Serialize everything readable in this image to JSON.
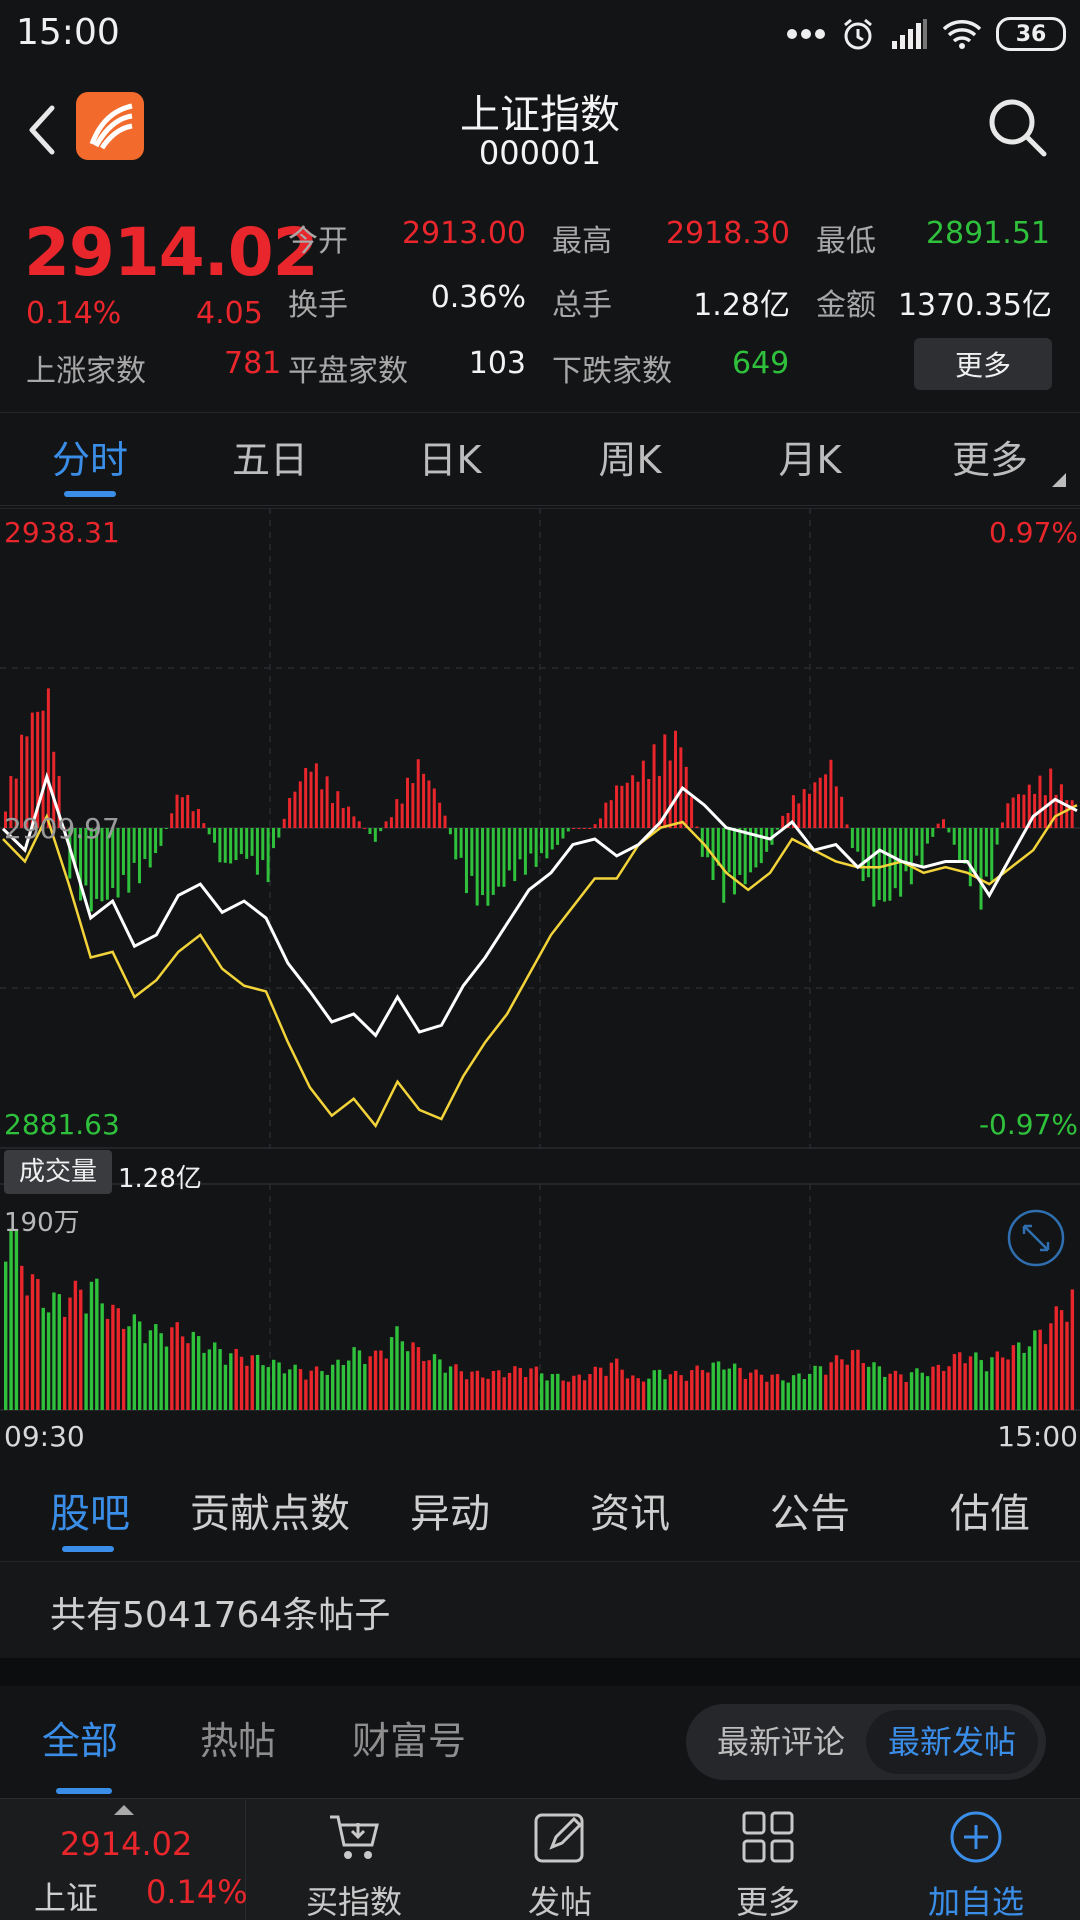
{
  "status_bar": {
    "time": "15:00",
    "battery": "36"
  },
  "header": {
    "title": "上证指数",
    "code": "000001"
  },
  "quote": {
    "price": "2914.02",
    "change_pct": "0.14%",
    "change": "4.05",
    "stats": [
      {
        "label": "今开",
        "value": "2913.00",
        "color": "red"
      },
      {
        "label": "最高",
        "value": "2918.30",
        "color": "red"
      },
      {
        "label": "最低",
        "value": "2891.51",
        "color": "green"
      },
      {
        "label": "换手",
        "value": "0.36%",
        "color": "white"
      },
      {
        "label": "总手",
        "value": "1.28亿",
        "color": "white"
      },
      {
        "label": "金额",
        "value": "1370.35亿",
        "color": "white"
      }
    ],
    "rise_label": "上涨家数",
    "rise_count": "781",
    "flat_label": "平盘家数",
    "flat_count": "103",
    "fall_label": "下跌家数",
    "fall_count": "649",
    "more_label": "更多"
  },
  "period_tabs": [
    "分时",
    "五日",
    "日K",
    "周K",
    "月K",
    "更多"
  ],
  "chart": {
    "y_high": "2938.31",
    "y_mid": "2909.97",
    "y_low": "2881.63",
    "pct_high": "0.97%",
    "pct_low": "-0.97%",
    "volume_label": "成交量",
    "volume_value": "1.28亿",
    "volume_max": "190万",
    "time_start": "09:30",
    "time_end": "15:00",
    "colors": {
      "up": "#e8262b",
      "down": "#2fc13c",
      "price_line": "#ffffff",
      "avg_line": "#f2d43a"
    }
  },
  "chart_data": {
    "type": "line",
    "title": "",
    "x_range": [
      "09:30",
      "15:00"
    ],
    "ylim": [
      2881.63,
      2938.31
    ],
    "prev_close": 2909.97,
    "series": [
      {
        "values": [
          2909.9,
          2908.0,
          2914.5,
          2908.5,
          2902.0,
          2903.5,
          2899.5,
          2900.5,
          2904.0,
          2905.0,
          2902.5,
          2903.5,
          2902.0,
          2898.0,
          2895.5,
          2892.8,
          2893.5,
          2891.6,
          2895.0,
          2891.9,
          2892.5,
          2896.0,
          2898.5,
          2901.5,
          2904.5,
          2906.0,
          2908.5,
          2909.0,
          2907.5,
          2908.5,
          2910.5,
          2913.5,
          2912.0,
          2910.0,
          2909.5,
          2909.0,
          2910.5,
          2908.0,
          2908.5,
          2906.5,
          2908.0,
          2907.0,
          2906.5,
          2907.0,
          2907.0,
          2904.0,
          2907.5,
          2911.0,
          2912.5,
          2911.5
        ]
      },
      {
        "values": [
          2909.0,
          2907.0,
          2911.0,
          2905.0,
          2898.5,
          2899.0,
          2895.0,
          2896.5,
          2899.0,
          2900.5,
          2897.5,
          2896.0,
          2895.5,
          2891.0,
          2887.0,
          2884.5,
          2886.0,
          2883.6,
          2887.5,
          2885.0,
          2884.2,
          2888.0,
          2891.0,
          2893.5,
          2897.0,
          2900.5,
          2903.0,
          2905.5,
          2905.5,
          2908.5,
          2910.0,
          2910.5,
          2908.5,
          2906.0,
          2904.5,
          2906.0,
          2909.0,
          2908.0,
          2907.0,
          2906.5,
          2906.5,
          2907.0,
          2906.0,
          2906.5,
          2906.0,
          2905.0,
          2906.5,
          2908.0,
          2911.0,
          2912.0
        ]
      }
    ],
    "advance_decline": [
      0.2,
      0.8,
      1.0,
      -0.4,
      -0.6,
      -0.5,
      -0.4,
      -0.2,
      0.3,
      0.1,
      -0.3,
      -0.2,
      -0.4,
      0.2,
      0.5,
      0.3,
      0.1,
      -0.1,
      0.2,
      0.5,
      0.2,
      -0.4,
      -0.6,
      -0.4,
      -0.3,
      -0.2,
      0.0,
      0.0,
      0.3,
      0.4,
      0.6,
      0.7,
      -0.2,
      -0.5,
      -0.4,
      -0.2,
      0.2,
      0.3,
      0.5,
      -0.2,
      -0.6,
      -0.5,
      -0.3,
      0.1,
      -0.3,
      -0.6,
      0.2,
      0.3,
      0.4,
      0.2
    ],
    "volume_ylim_label": "190万",
    "volume": [
      1.0,
      0.7,
      0.55,
      0.6,
      0.65,
      0.5,
      0.45,
      0.4,
      0.42,
      0.35,
      0.3,
      0.28,
      0.25,
      0.22,
      0.2,
      0.22,
      0.3,
      0.28,
      0.4,
      0.3,
      0.25,
      0.2,
      0.18,
      0.2,
      0.22,
      0.18,
      0.16,
      0.2,
      0.25,
      0.15,
      0.2,
      0.18,
      0.22,
      0.24,
      0.2,
      0.18,
      0.16,
      0.2,
      0.25,
      0.3,
      0.22,
      0.18,
      0.2,
      0.22,
      0.3,
      0.25,
      0.3,
      0.35,
      0.45,
      0.6
    ],
    "volume_up": [
      false,
      true,
      false,
      true,
      false,
      true,
      false,
      false,
      true,
      false,
      false,
      true,
      false,
      false,
      true,
      false,
      false,
      true,
      false,
      true,
      false,
      true,
      true,
      true,
      true,
      false,
      true,
      true,
      true,
      true,
      false,
      true,
      true,
      false,
      true,
      true,
      false,
      false,
      true,
      true,
      false,
      true,
      false,
      true,
      true,
      false,
      true,
      false,
      true,
      true
    ]
  },
  "info_tabs": [
    "股吧",
    "贡献点数",
    "异动",
    "资讯",
    "公告",
    "估值"
  ],
  "post_count_text": "共有5041764条帖子",
  "filter_tabs": [
    "全部",
    "热帖",
    "财富号"
  ],
  "sort_options": [
    "最新评论",
    "最新发帖"
  ],
  "bottom_nav": {
    "index_price": "2914.02",
    "index_name": "上证",
    "index_pct": "0.14%",
    "items": [
      {
        "label": "买指数",
        "icon": "cart-icon"
      },
      {
        "label": "发帖",
        "icon": "edit-icon"
      },
      {
        "label": "更多",
        "icon": "grid-icon"
      },
      {
        "label": "加自选",
        "icon": "add-circle-icon"
      }
    ]
  }
}
